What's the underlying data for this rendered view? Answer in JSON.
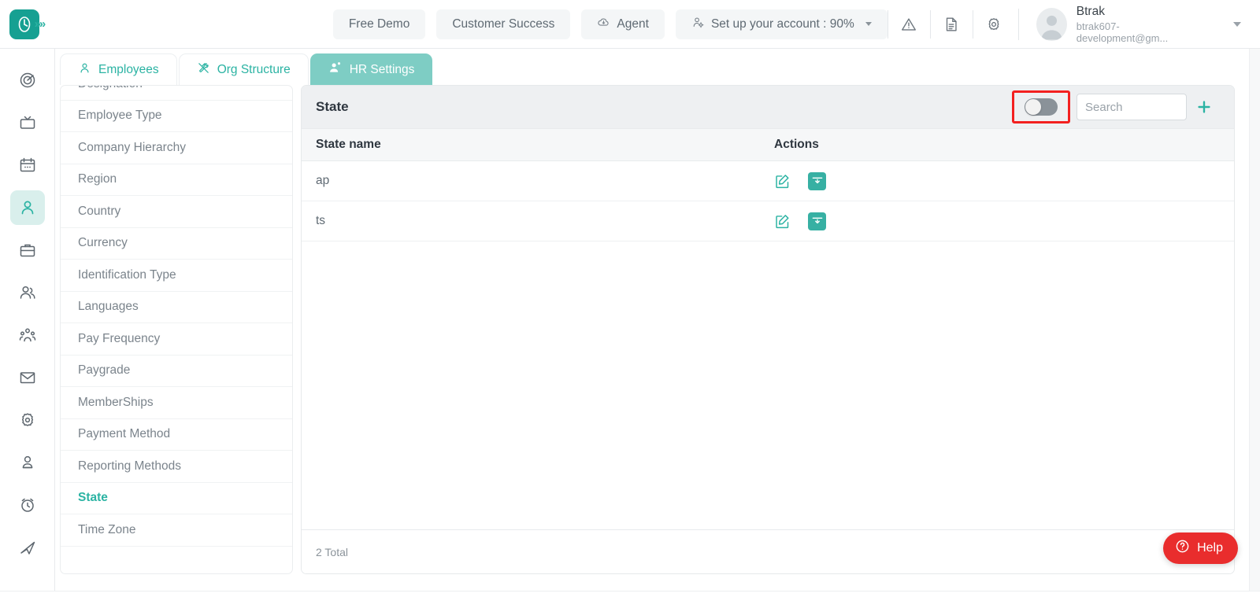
{
  "header": {
    "logo_icon": "clock-logo-icon",
    "expand_icon": "chevrons-right-icon",
    "buttons": [
      {
        "label": "Free Demo",
        "icon": null
      },
      {
        "label": "Customer Success",
        "icon": null
      },
      {
        "label": "Agent",
        "icon": "cloud-agent-icon"
      }
    ],
    "account_setup": {
      "label": "Set up your account : 90%",
      "icon": "user-gear-icon"
    },
    "icons": [
      "warning-triangle-icon",
      "document-icon",
      "gear-icon"
    ],
    "user": {
      "name": "Btrak",
      "email": "btrak607-development@gm...",
      "avatar_icon": "user-avatar-icon",
      "caret_icon": "chevron-down-icon"
    }
  },
  "rail": {
    "items": [
      {
        "name": "dashboard-target-icon",
        "active": false
      },
      {
        "name": "tv-icon",
        "active": false
      },
      {
        "name": "calendar-icon",
        "active": false
      },
      {
        "name": "person-icon",
        "active": true
      },
      {
        "name": "briefcase-icon",
        "active": false
      },
      {
        "name": "people-icon",
        "active": false
      },
      {
        "name": "org-group-icon",
        "active": false
      },
      {
        "name": "mail-icon",
        "active": false
      },
      {
        "name": "settings-gear-icon",
        "active": false
      },
      {
        "name": "user-profile-icon",
        "active": false
      },
      {
        "name": "alarm-clock-icon",
        "active": false
      },
      {
        "name": "send-icon",
        "active": false
      }
    ]
  },
  "tabs": [
    {
      "label": "Employees",
      "icon": "person-icon",
      "active": false
    },
    {
      "label": "Org Structure",
      "icon": "tools-icon",
      "active": false
    },
    {
      "label": "HR Settings",
      "icon": "people-gear-icon",
      "active": true
    }
  ],
  "settings_list": {
    "items": [
      {
        "label": "Designation",
        "active": false
      },
      {
        "label": "Employee Type",
        "active": false
      },
      {
        "label": "Company Hierarchy",
        "active": false
      },
      {
        "label": "Region",
        "active": false
      },
      {
        "label": "Country",
        "active": false
      },
      {
        "label": "Currency",
        "active": false
      },
      {
        "label": "Identification Type",
        "active": false
      },
      {
        "label": "Languages",
        "active": false
      },
      {
        "label": "Pay Frequency",
        "active": false
      },
      {
        "label": "Paygrade",
        "active": false
      },
      {
        "label": "MemberShips",
        "active": false
      },
      {
        "label": "Payment Method",
        "active": false
      },
      {
        "label": "Reporting Methods",
        "active": false
      },
      {
        "label": "State",
        "active": true
      },
      {
        "label": "Time Zone",
        "active": false
      }
    ]
  },
  "panel": {
    "title": "State",
    "toggle": {
      "name": "archive-toggle",
      "state": "off",
      "highlighted": true
    },
    "search": {
      "placeholder": "Search",
      "value": ""
    },
    "add_icon": "plus-icon",
    "columns": [
      "State name",
      "Actions"
    ],
    "rows": [
      {
        "state_name": "ap",
        "actions": [
          "edit-icon",
          "archive-icon"
        ]
      },
      {
        "state_name": "ts",
        "actions": [
          "edit-icon",
          "archive-icon"
        ]
      }
    ],
    "total_text": "2 Total"
  },
  "help": {
    "label": "Help",
    "icon": "question-circle-icon"
  },
  "colors": {
    "accent_teal": "#2bb3a3",
    "tab_active": "#7ecdc4",
    "logo_teal": "#16a092",
    "highlight_red": "#f32020",
    "help_red": "#e92d2d",
    "toggle_off": "#8a9299"
  }
}
